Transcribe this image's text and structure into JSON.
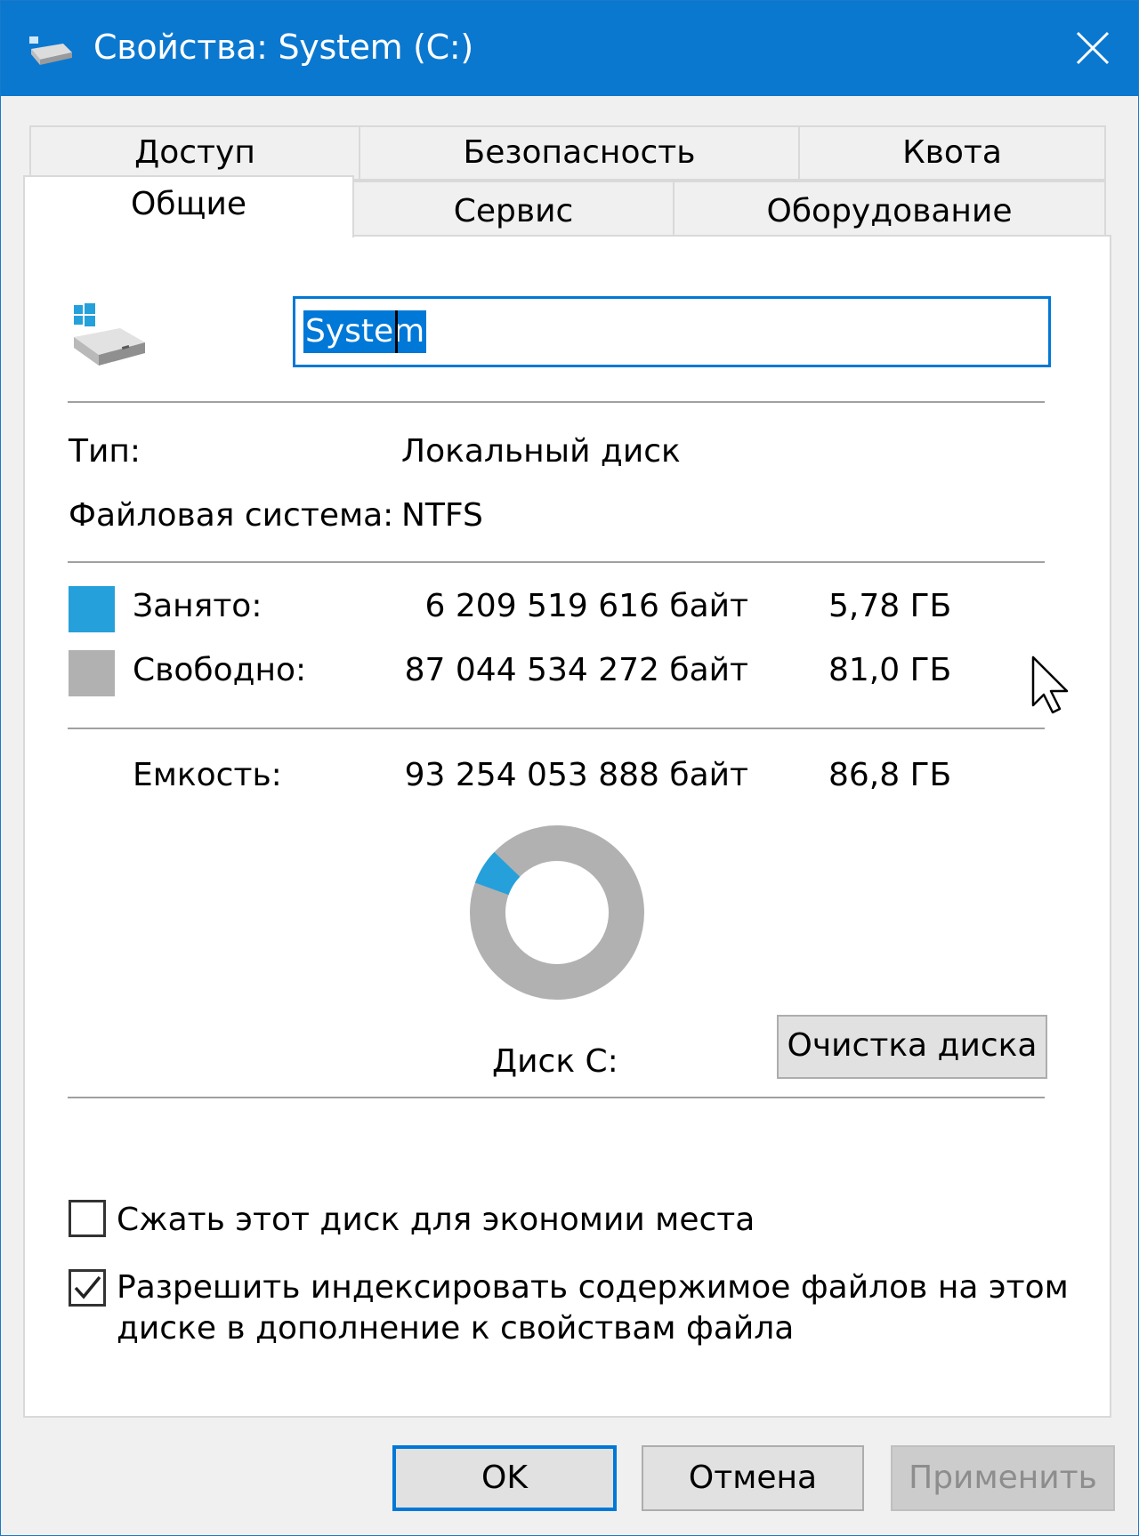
{
  "window": {
    "title": "Свойства: System (C:)",
    "accent_color": "#0b78d0"
  },
  "tabs": {
    "row1": [
      {
        "label": "Доступ"
      },
      {
        "label": "Безопасность"
      },
      {
        "label": "Квота"
      }
    ],
    "row2": [
      {
        "label": "Общие",
        "selected": true
      },
      {
        "label": "Сервис"
      },
      {
        "label": "Оборудование"
      }
    ]
  },
  "general": {
    "drive_icon": "windows-drive-icon",
    "volume_name": "System",
    "type_label": "Тип:",
    "type_value": "Локальный диск",
    "fs_label": "Файловая система:",
    "fs_value": "NTFS",
    "used": {
      "label": "Занято:",
      "bytes": "6 209 519 616 байт",
      "size": "5,78 ГБ",
      "color": "#26a0da"
    },
    "free": {
      "label": "Свободно:",
      "bytes": "87 044 534 272 байт",
      "size": "81,0 ГБ",
      "color": "#b1b1b1"
    },
    "capacity": {
      "label": "Емкость:",
      "bytes": "93 254 053 888 байт",
      "size": "86,8 ГБ"
    },
    "used_fraction": 0.0666,
    "drive_label": "Диск C:",
    "cleanup_button": "Очистка диска",
    "compress_label": "Сжать этот диск для экономии места",
    "compress_checked": false,
    "index_label_line1": "Разрешить индексировать содержимое файлов на этом",
    "index_label_line2": "диске в дополнение к свойствам файла",
    "index_checked": true
  },
  "buttons": {
    "ok": "OK",
    "cancel": "Отмена",
    "apply": "Применить"
  }
}
